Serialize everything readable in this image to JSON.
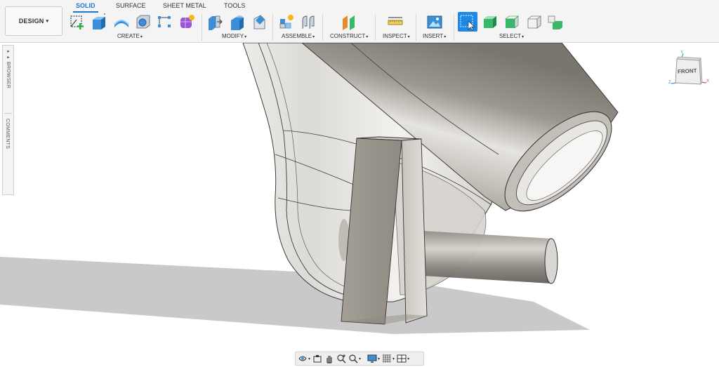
{
  "workspace": {
    "label": "DESIGN",
    "caret": "▾"
  },
  "tabs": [
    {
      "label": "SOLID",
      "active": true
    },
    {
      "label": "SURFACE",
      "active": false
    },
    {
      "label": "SHEET METAL",
      "active": false
    },
    {
      "label": "TOOLS",
      "active": false
    }
  ],
  "groups": [
    {
      "label": "CREATE",
      "caret": "▾",
      "tools": [
        "create-sketch-icon",
        "extrude-icon",
        "revolve-icon",
        "hole-icon",
        "rectangular-pattern-icon",
        "form-icon"
      ]
    },
    {
      "label": "MODIFY",
      "caret": "▾",
      "tools": [
        "press-pull-icon",
        "fillet-icon",
        "chamfer-icon"
      ]
    },
    {
      "label": "ASSEMBLE",
      "caret": "▾",
      "tools": [
        "new-component-icon",
        "joint-icon"
      ]
    },
    {
      "label": "CONSTRUCT",
      "caret": "▾",
      "tools": [
        "offset-plane-icon"
      ]
    },
    {
      "label": "INSPECT",
      "caret": "▾",
      "tools": [
        "measure-icon"
      ]
    },
    {
      "label": "INSERT",
      "caret": "▾",
      "tools": [
        "insert-canvas-icon"
      ]
    },
    {
      "label": "SELECT",
      "caret": "▾",
      "tools": [
        "select-icon",
        "window-select-icon",
        "box-icon-1",
        "box-icon-2",
        "box-icon-3"
      ]
    }
  ],
  "side_panel": {
    "browser_label": "▸▸ BROWSER",
    "comments_label": "COMMENTS"
  },
  "viewcube": {
    "face_label": "FRONT",
    "axis_x": "X",
    "axis_y": "Y",
    "axis_z": "Z"
  },
  "navbar": {
    "items": [
      "orbit-icon",
      "look-at-icon",
      "pan-icon",
      "zoom-icon",
      "fit-icon",
      "display-settings-icon",
      "grid-icon",
      "viewports-icon"
    ],
    "caret": "▾"
  },
  "colors": {
    "accent": "#1a7bd6",
    "toolbar_bg": "#f4f4f4",
    "model_metal": "#a8a39a",
    "select_blue": "#1e88e5",
    "select_green": "#3ab86a"
  }
}
